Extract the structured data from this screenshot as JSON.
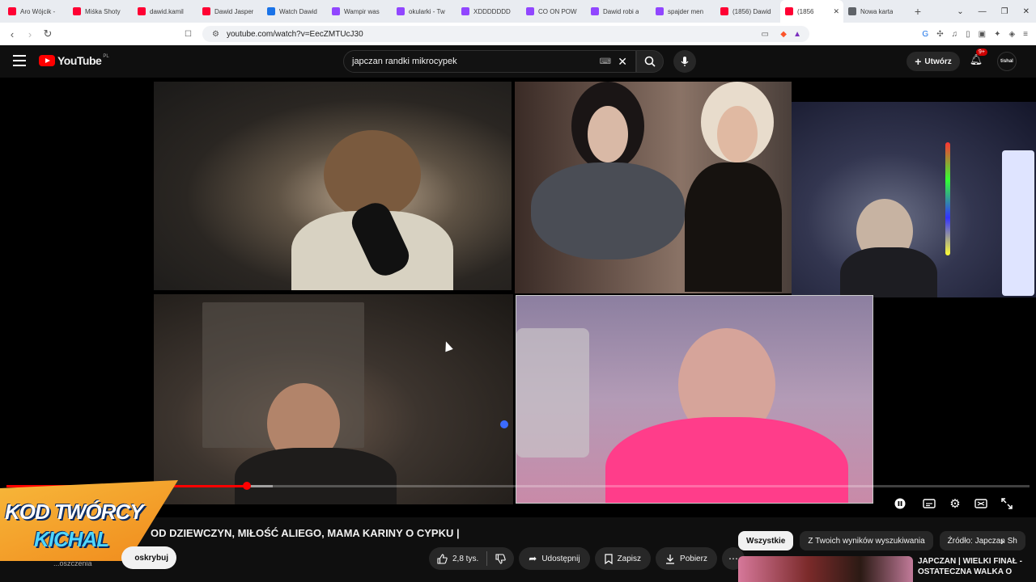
{
  "browser": {
    "tabs": [
      {
        "title": "Aro Wójcik -",
        "color": "#ff0033"
      },
      {
        "title": "Miśka Shoty",
        "color": "#ff0033"
      },
      {
        "title": "dawid.kamil",
        "color": "#ff0033"
      },
      {
        "title": "Dawid Jasper",
        "color": "#ff0033"
      },
      {
        "title": "Watch Dawid",
        "color": "#1a73e8"
      },
      {
        "title": "Wampir was",
        "color": "#9146ff"
      },
      {
        "title": "okularki - Tw",
        "color": "#9146ff"
      },
      {
        "title": "XDDDDDDD",
        "color": "#9146ff"
      },
      {
        "title": "CO ON POW",
        "color": "#9146ff"
      },
      {
        "title": "Dawid robi a",
        "color": "#9146ff"
      },
      {
        "title": "spajder men",
        "color": "#9146ff"
      },
      {
        "title": "(1856) Dawid",
        "color": "#ff0033"
      },
      {
        "title": "(1856",
        "color": "#ff0033"
      },
      {
        "title": "Nowa karta",
        "color": "#5f6368"
      }
    ],
    "url": "youtube.com/watch?v=EecZMTUcJ30",
    "new_tab_symbol": "+"
  },
  "youtube": {
    "logo_text": "YouTube",
    "country_code": "PL",
    "search_query": "japczan randki mikrocypek",
    "create_label": "Utwórz",
    "notification_count": "9+",
    "avatar_text": "tishal"
  },
  "player": {
    "progress_fraction": 0.235,
    "buffered_fraction": 0.26
  },
  "overlay": {
    "line1": "KOD TWÓRCY",
    "line2": "KICHAL"
  },
  "video": {
    "title": "OD DZIEWCZYN, MIŁOŚĆ ALIEGO, MAMA KARINY O CYPKU |",
    "channel_partial": "...oszczenia",
    "subscribe_label": "oskrybuj",
    "likes": "2,8 tys.",
    "share_label": "Udostępnij",
    "save_label": "Zapisz",
    "download_label": "Pobierz"
  },
  "sidebar": {
    "chips": [
      "Wszystkie",
      "Z Twoich wyników wyszukiwania",
      "Źródło: Japczan Sh"
    ],
    "rec_title": "JAPCZAN | WIELKI FINAŁ - OSTATECZNA WALKA O"
  },
  "colors": {
    "brand_red": "#ff0000",
    "progress_red": "#ff0000",
    "overlay_orange": "#f5a623",
    "overlay_cyan": "#4fd6ff"
  },
  "icons": [
    "menu-icon",
    "search-icon",
    "mic-icon",
    "plus-icon",
    "bell-icon",
    "like-icon",
    "dislike-icon",
    "share-icon",
    "save-icon",
    "download-icon",
    "more-icon",
    "pause-icon",
    "subtitles-icon",
    "settings-icon",
    "miniplayer-icon",
    "fullscreen-icon"
  ]
}
